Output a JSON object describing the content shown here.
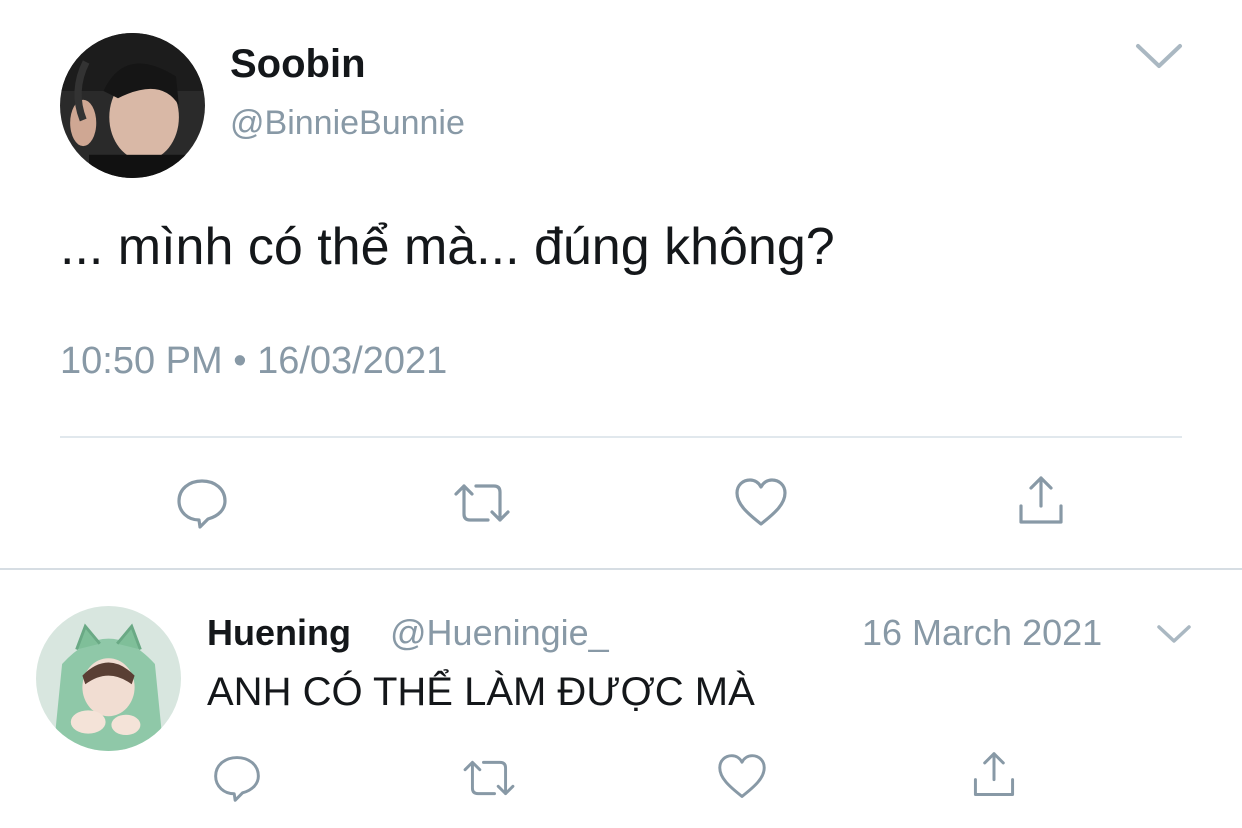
{
  "tweet": {
    "author_name": "Soobin",
    "author_handle": "@BinnieBunnie",
    "text": "... mình có thể mà... đúng không?",
    "time": "10:50 PM",
    "separator": "•",
    "date": "16/03/2021",
    "avatar_icon": "profile-photo-avatar"
  },
  "reply": {
    "author_name": "Huening",
    "author_handle": "@Hueningie_",
    "date": "16 March 2021",
    "text": "ANH CÓ THỂ LÀM ĐƯỢC MÀ",
    "avatar_icon": "profile-photo-avatar"
  },
  "actions": [
    "reply-icon",
    "retweet-icon",
    "like-icon",
    "share-icon"
  ],
  "colors": {
    "text": "#14171a",
    "secondary_text": "#8899a6",
    "divider": "#e1e8ed",
    "background": "#ffffff"
  }
}
